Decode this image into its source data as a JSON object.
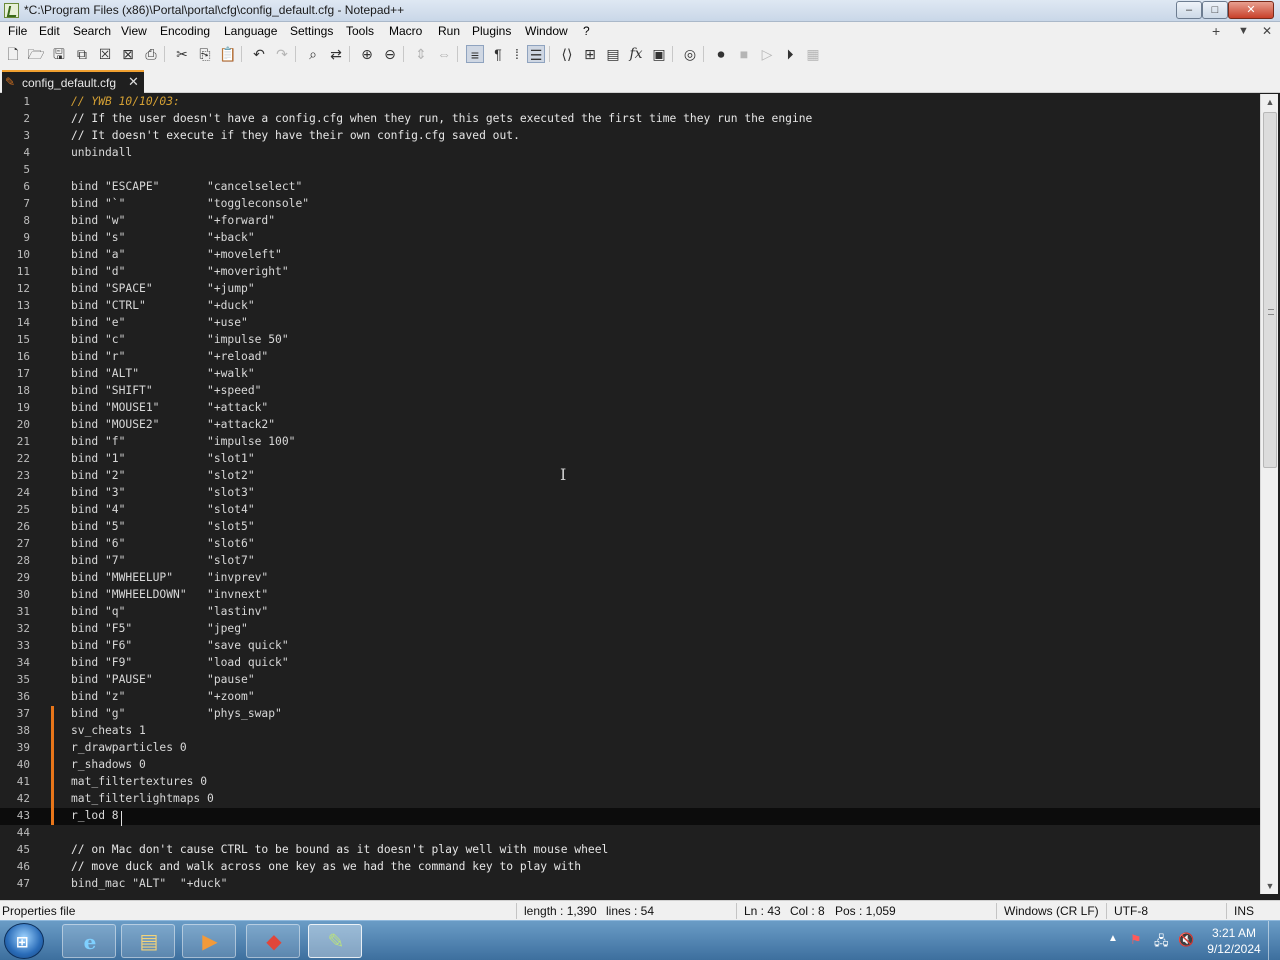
{
  "window": {
    "title": "*C:\\Program Files (x86)\\Portal\\portal\\cfg\\config_default.cfg - Notepad++",
    "controls": {
      "minimize": "–",
      "maximize": "□",
      "close": "✕"
    }
  },
  "menu": {
    "items": [
      "File",
      "Edit",
      "Search",
      "View",
      "Encoding",
      "Language",
      "Settings",
      "Tools",
      "Macro",
      "Run",
      "Plugins",
      "Window",
      "?"
    ],
    "right": {
      "add": "+",
      "dropdown": "▼",
      "close": "✕"
    }
  },
  "toolbar": {
    "icons": [
      "new-file-icon",
      "open-file-icon",
      "save-icon",
      "save-all-icon",
      "close-icon",
      "close-all-icon",
      "print-icon",
      "cut-icon",
      "copy-icon",
      "paste-icon",
      "undo-icon",
      "redo-icon",
      "find-icon",
      "replace-icon",
      "zoom-in-icon",
      "zoom-out-icon",
      "sync-vertical-icon",
      "sync-horizontal-icon",
      "word-wrap-icon",
      "show-all-chars-icon",
      "indent-guide-icon",
      "outline-icon",
      "xml-tag-icon",
      "document-map-icon",
      "document-list-icon",
      "function-list-icon",
      "folder-workspace-icon",
      "monitoring-icon",
      "record-macro-icon",
      "stop-record-icon",
      "play-macro-icon",
      "run-macro-multiple-icon",
      "save-macro-icon"
    ]
  },
  "tab": {
    "label": "config_default.cfg",
    "close": "✕",
    "modified": true
  },
  "editor": {
    "current_line": 43,
    "lines": [
      {
        "n": "1",
        "text": "// YWB 10/10/03:",
        "style": "orange"
      },
      {
        "n": "2",
        "text": "// If the user doesn't have a config.cfg when they run, this gets executed the first time they run the engine",
        "style": "comment"
      },
      {
        "n": "3",
        "text": "// It doesn't execute if they have their own config.cfg saved out.",
        "style": "comment"
      },
      {
        "n": "4",
        "text": "unbindall"
      },
      {
        "n": "5",
        "text": ""
      },
      {
        "n": "6",
        "text": "bind \"ESCAPE\"       \"cancelselect\""
      },
      {
        "n": "7",
        "text": "bind \"`\"            \"toggleconsole\""
      },
      {
        "n": "8",
        "text": "bind \"w\"            \"+forward\""
      },
      {
        "n": "9",
        "text": "bind \"s\"            \"+back\""
      },
      {
        "n": "10",
        "text": "bind \"a\"            \"+moveleft\""
      },
      {
        "n": "11",
        "text": "bind \"d\"            \"+moveright\""
      },
      {
        "n": "12",
        "text": "bind \"SPACE\"        \"+jump\""
      },
      {
        "n": "13",
        "text": "bind \"CTRL\"         \"+duck\""
      },
      {
        "n": "14",
        "text": "bind \"e\"            \"+use\""
      },
      {
        "n": "15",
        "text": "bind \"c\"            \"impulse 50\""
      },
      {
        "n": "16",
        "text": "bind \"r\"            \"+reload\""
      },
      {
        "n": "17",
        "text": "bind \"ALT\"          \"+walk\""
      },
      {
        "n": "18",
        "text": "bind \"SHIFT\"        \"+speed\""
      },
      {
        "n": "19",
        "text": "bind \"MOUSE1\"       \"+attack\""
      },
      {
        "n": "20",
        "text": "bind \"MOUSE2\"       \"+attack2\""
      },
      {
        "n": "21",
        "text": "bind \"f\"            \"impulse 100\""
      },
      {
        "n": "22",
        "text": "bind \"1\"            \"slot1\""
      },
      {
        "n": "23",
        "text": "bind \"2\"            \"slot2\""
      },
      {
        "n": "24",
        "text": "bind \"3\"            \"slot3\""
      },
      {
        "n": "25",
        "text": "bind \"4\"            \"slot4\""
      },
      {
        "n": "26",
        "text": "bind \"5\"            \"slot5\""
      },
      {
        "n": "27",
        "text": "bind \"6\"            \"slot6\""
      },
      {
        "n": "28",
        "text": "bind \"7\"            \"slot7\""
      },
      {
        "n": "29",
        "text": "bind \"MWHEELUP\"     \"invprev\""
      },
      {
        "n": "30",
        "text": "bind \"MWHEELDOWN\"   \"invnext\""
      },
      {
        "n": "31",
        "text": "bind \"q\"            \"lastinv\""
      },
      {
        "n": "32",
        "text": "bind \"F5\"           \"jpeg\""
      },
      {
        "n": "33",
        "text": "bind \"F6\"           \"save quick\""
      },
      {
        "n": "34",
        "text": "bind \"F9\"           \"load quick\""
      },
      {
        "n": "35",
        "text": "bind \"PAUSE\"        \"pause\""
      },
      {
        "n": "36",
        "text": "bind \"z\"            \"+zoom\""
      },
      {
        "n": "37",
        "text": "bind \"g\"            \"phys_swap\"",
        "changed": true
      },
      {
        "n": "38",
        "text": "sv_cheats 1",
        "changed": true
      },
      {
        "n": "39",
        "text": "r_drawparticles 0",
        "changed": true
      },
      {
        "n": "40",
        "text": "r_shadows 0",
        "changed": true
      },
      {
        "n": "41",
        "text": "mat_filtertextures 0",
        "changed": true
      },
      {
        "n": "42",
        "text": "mat_filterlightmaps 0",
        "changed": true
      },
      {
        "n": "43",
        "text": "r_lod 8",
        "changed": true
      },
      {
        "n": "44",
        "text": ""
      },
      {
        "n": "45",
        "text": "// on Mac don't cause CTRL to be bound as it doesn't play well with mouse wheel",
        "style": "comment"
      },
      {
        "n": "46",
        "text": "// move duck and walk across one key as we had the command key to play with",
        "style": "comment"
      },
      {
        "n": "47",
        "text": "bind_mac \"ALT\"  \"+duck\""
      }
    ]
  },
  "statusbar": {
    "file_type": "Properties file",
    "length": "length : 1,390",
    "lines": "lines : 54",
    "ln": "Ln : 43",
    "col": "Col : 8",
    "pos": "Pos : 1,059",
    "eol": "Windows (CR LF)",
    "encoding": "UTF-8",
    "mode": "INS"
  },
  "taskbar": {
    "apps": [
      "internet-explorer-icon",
      "file-explorer-icon",
      "media-player-icon",
      "app-icon",
      "notepad-plus-plus-icon"
    ],
    "tray_arrow": "▲",
    "time": "3:21 AM",
    "date": "9/12/2024"
  },
  "colors": {
    "accent_tab": "#f0a030",
    "change_marker": "#e8761a",
    "editor_bg": "#1f1f1f",
    "comment_highlight": "#d4a034"
  }
}
